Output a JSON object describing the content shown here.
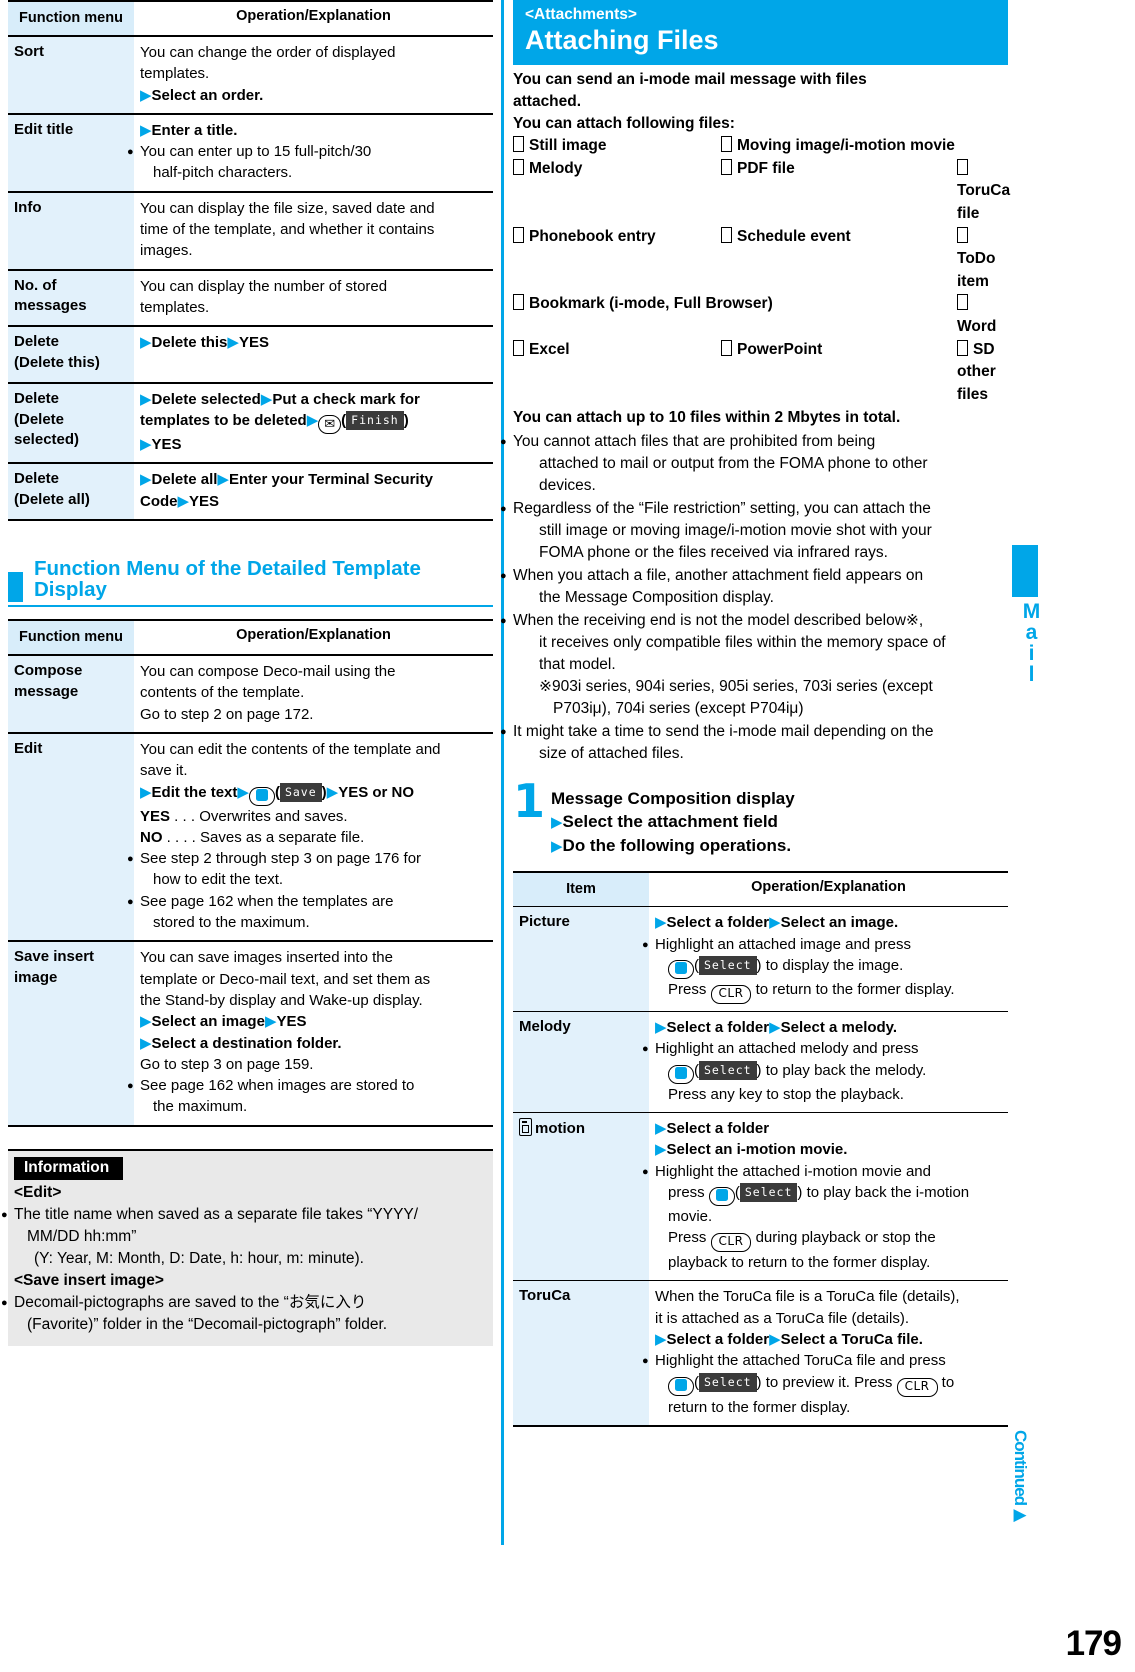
{
  "page_number": "179",
  "side_tab_label": "Mail",
  "continued_label": "Continued",
  "colors": {
    "accent": "#00a6e8",
    "table_header_cell": "#e2f1fb",
    "info_bg": "#e9e9e9"
  },
  "left": {
    "table1": {
      "headers": [
        "Function menu",
        "Operation/Explanation"
      ],
      "rows": [
        {
          "menu": "Sort",
          "lines": [
            {
              "t": "plain",
              "text": "You can change the order of displayed"
            },
            {
              "t": "plain",
              "text": "templates."
            },
            {
              "t": "arrow_bold",
              "text": "Select an order."
            }
          ]
        },
        {
          "menu": "Edit title",
          "lines": [
            {
              "t": "arrow_bold",
              "text": "Enter a title."
            },
            {
              "t": "bullet",
              "text": "You can enter up to 15 full-pitch/30"
            },
            {
              "t": "cont",
              "text": "half-pitch characters."
            }
          ]
        },
        {
          "menu": "Info",
          "lines": [
            {
              "t": "plain",
              "text": "You can display the file size, saved date and"
            },
            {
              "t": "plain",
              "text": "time of the template, and whether it contains"
            },
            {
              "t": "plain",
              "text": "images."
            }
          ]
        },
        {
          "menu": "No. of\nmessages",
          "lines": [
            {
              "t": "plain",
              "text": "You can display the number of stored"
            },
            {
              "t": "plain",
              "text": "templates."
            }
          ]
        },
        {
          "menu": "Delete\n(Delete this)",
          "lines": [
            {
              "t": "steps",
              "text": "Delete this|YES"
            }
          ]
        },
        {
          "menu": "Delete\n(Delete\nselected)",
          "lines": [
            {
              "t": "html_delsel",
              "text": ""
            }
          ]
        },
        {
          "menu": "Delete\n(Delete all)",
          "lines": [
            {
              "t": "steps",
              "text": "Delete all|Enter your Terminal Security Code|YES"
            }
          ]
        }
      ]
    },
    "section_title": "Function Menu of the Detailed Template Display",
    "table2": {
      "headers": [
        "Function menu",
        "Operation/Explanation"
      ],
      "rows": [
        {
          "menu": "Compose\nmessage",
          "lines": [
            {
              "t": "plain",
              "text": "You can compose Deco-mail using the"
            },
            {
              "t": "plain",
              "text": "contents of the template."
            },
            {
              "t": "plain",
              "text": "Go to step 2 on page 172."
            }
          ]
        },
        {
          "menu": "Edit",
          "lines": [
            {
              "t": "plain",
              "text": "You can edit the contents of the template and"
            },
            {
              "t": "plain",
              "text": "save it."
            },
            {
              "t": "html_edit",
              "text": ""
            },
            {
              "t": "defn",
              "text": "YES . . . Overwrites and saves."
            },
            {
              "t": "defn",
              "text": "NO . . . . Saves as a separate file."
            },
            {
              "t": "bullet",
              "text": "See step 2 through step 3 on page 176 for"
            },
            {
              "t": "cont",
              "text": "how to edit the text."
            },
            {
              "t": "bullet",
              "text": "See page 162 when the templates are"
            },
            {
              "t": "cont",
              "text": "stored to the maximum."
            }
          ]
        },
        {
          "menu": "Save insert\nimage",
          "lines": [
            {
              "t": "plain",
              "text": "You can save images inserted into the"
            },
            {
              "t": "plain",
              "text": "template or Deco-mail text, and set them as"
            },
            {
              "t": "plain",
              "text": "the Stand-by display and Wake-up display."
            },
            {
              "t": "steps",
              "text": "Select an image|YES"
            },
            {
              "t": "arrow_bold",
              "text": "Select a destination folder."
            },
            {
              "t": "plain",
              "text": "Go to step 3 on page 159."
            },
            {
              "t": "bullet",
              "text": "See page 162 when images are stored to"
            },
            {
              "t": "cont",
              "text": "the maximum."
            }
          ]
        }
      ]
    },
    "information": {
      "tag": "Information",
      "blocks": [
        {
          "heading": "<Edit>",
          "lines": [
            {
              "t": "bullet",
              "text": "The title name when saved as a separate file takes “YYYY/"
            },
            {
              "t": "cont",
              "text": "MM/DD hh:mm”"
            },
            {
              "t": "cont2",
              "text": "(Y: Year, M: Month, D: Date, h: hour, m: minute)."
            }
          ]
        },
        {
          "heading": "<Save insert image>",
          "lines": [
            {
              "t": "bullet",
              "text": "Decomail-pictographs are saved to the “お気に入り"
            },
            {
              "t": "cont",
              "text": "(Favorite)” folder in the “Decomail-pictograph” folder."
            }
          ]
        }
      ]
    }
  },
  "right": {
    "header": {
      "tag": "<Attachments>",
      "title": "Attaching Files"
    },
    "lead": [
      "You can send an i-mode mail message with files",
      "attached.",
      "You can attach following files:"
    ],
    "file_types": [
      "Still image",
      "Moving image/i-motion movie",
      "",
      "Melody",
      "PDF file",
      "ToruCa file",
      "Phonebook entry",
      "Schedule event",
      "ToDo item",
      "Bookmark (i-mode, Full Browser)",
      "Word",
      "Excel",
      "PowerPoint",
      "SD other files"
    ],
    "capacity_note": "You can attach up to 10 files within 2 Mbytes in total.",
    "notes": [
      [
        "You cannot attach files that are prohibited from being",
        "attached to mail or output from the FOMA phone to other",
        "devices."
      ],
      [
        "Regardless of the “File restriction” setting, you can attach the",
        "still image or moving image/i-motion movie shot with your",
        "FOMA phone or the files received via infrared rays."
      ],
      [
        "When you attach a file, another attachment field appears on",
        "the Message Composition display."
      ],
      [
        "When the receiving end is not the model described below※,",
        "it receives only compatible files within the memory space of",
        "that model."
      ],
      [
        "It might take a time to send the i-mode mail depending on the",
        "size of attached files."
      ]
    ],
    "footnote": [
      "※903i series, 904i series, 905i series, 703i series (except",
      "P703iμ), 704i series (except P704iμ)"
    ],
    "step": {
      "number": "1",
      "line1": "Message Composition display",
      "line2": "Select the attachment field",
      "line3": "Do the following operations."
    },
    "table": {
      "headers": [
        "Item",
        "Operation/Explanation"
      ],
      "rows": [
        {
          "item": "Picture",
          "kind": "picture"
        },
        {
          "item": "Melody",
          "kind": "melody"
        },
        {
          "item": "motion",
          "kind": "imotion",
          "icon": "i-motion-icon"
        },
        {
          "item": "ToruCa",
          "kind": "toruca"
        }
      ],
      "picture": {
        "steps": "Select a folder|Select an image.",
        "l1a": "Highlight an attached image and press",
        "l2a": "(",
        "l2b": "Select",
        "l2c": ") to display the image.",
        "l3a": "Press",
        "l3b": "CLR",
        "l3c": "to return to the former display."
      },
      "melody": {
        "steps": "Select a folder|Select a melody.",
        "l1a": "Highlight an attached melody and press",
        "l2a": "(",
        "l2b": "Select",
        "l2c": ") to play back the melody.",
        "l3": "Press any key to stop the playback."
      },
      "imotion": {
        "step1": "Select a folder",
        "step2": "Select an i-motion movie.",
        "l1a": "Highlight the attached i-motion movie and",
        "l2a": "press",
        "l2b": "Select",
        "l2c": ") to play back the i-motion",
        "l3": "movie.",
        "l4a": "Press",
        "l4b": "CLR",
        "l4c": "during playback or stop the",
        "l5": "playback to return to the former display."
      },
      "toruca": {
        "l1": "When the ToruCa file is a ToruCa file (details),",
        "l2": "it is attached as a ToruCa file (details).",
        "steps": "Select a folder|Select a ToruCa file.",
        "l3a": "Highlight the attached ToruCa file and press",
        "l4a": "(",
        "l4b": "Select",
        "l4c": ") to preview it. Press",
        "l4d": "CLR",
        "l4e": "to",
        "l5": "return to the former display."
      }
    }
  }
}
